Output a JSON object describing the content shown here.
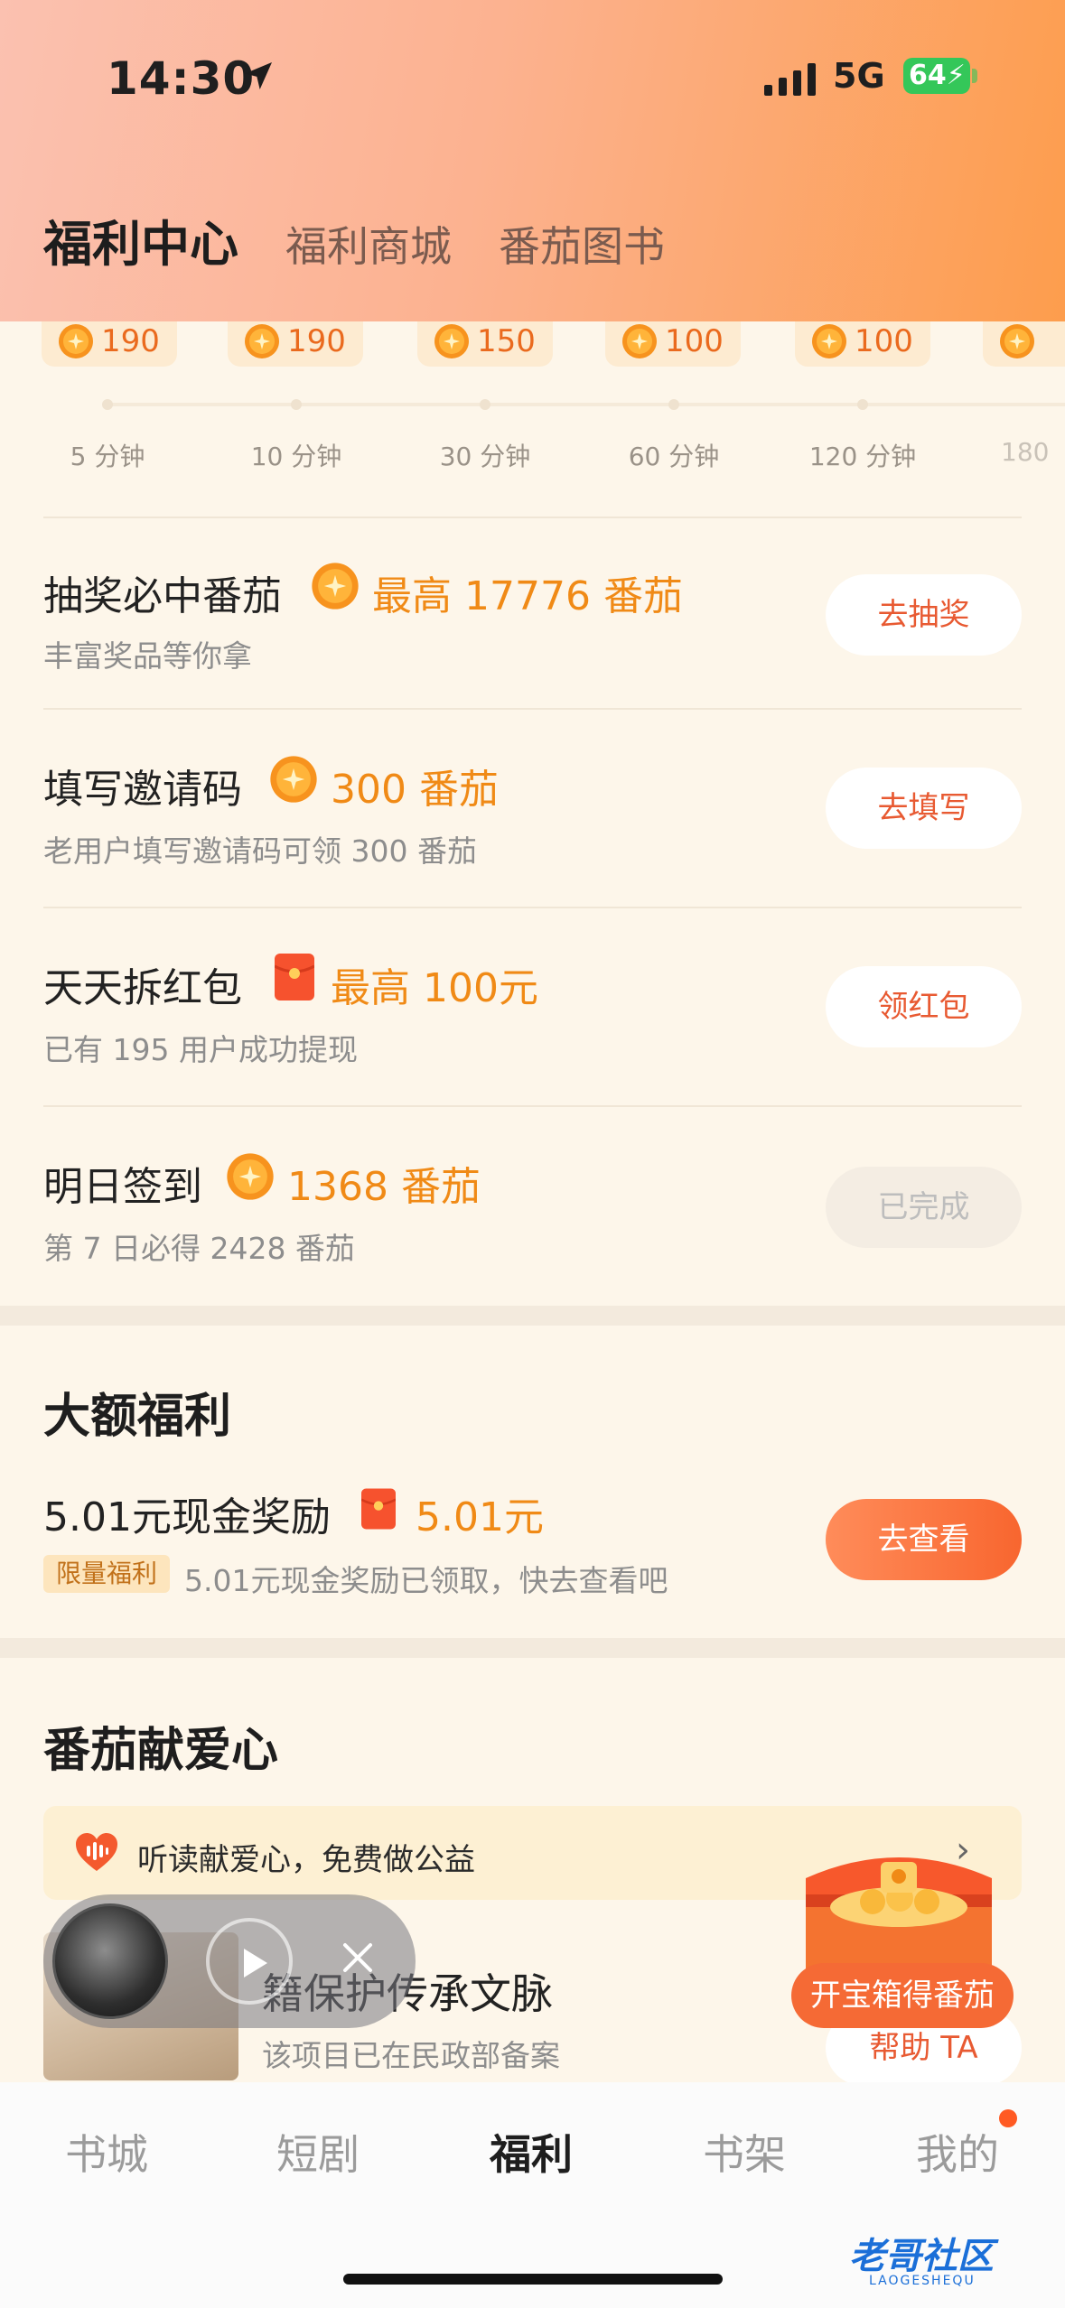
{
  "status_bar": {
    "time": "14:30",
    "network": "5G",
    "battery": "64"
  },
  "header": {
    "tabs": [
      "福利中心",
      "福利商城",
      "番茄图书"
    ],
    "active_tab": 0
  },
  "reading_rewards": [
    {
      "coins": "190",
      "duration": "5 分钟"
    },
    {
      "coins": "190",
      "duration": "10 分钟"
    },
    {
      "coins": "150",
      "duration": "30 分钟"
    },
    {
      "coins": "100",
      "duration": "60 分钟"
    },
    {
      "coins": "100",
      "duration": "120 分钟"
    },
    {
      "coins": "",
      "duration": "180"
    }
  ],
  "tasks": [
    {
      "title": "抽奖必中番茄",
      "reward": "最高 17776 番茄",
      "subtitle": "丰富奖品等你拿",
      "button": "去抽奖",
      "icon": "coin-icon",
      "state": "active"
    },
    {
      "title": "填写邀请码",
      "reward": "300 番茄",
      "subtitle": "老用户填写邀请码可领 300 番茄",
      "button": "去填写",
      "icon": "coin-icon",
      "state": "active"
    },
    {
      "title": "天天拆红包",
      "reward": "最高 100元",
      "subtitle": "已有 195 用户成功提现",
      "button": "领红包",
      "icon": "red-envelope-icon",
      "state": "active"
    },
    {
      "title": "明日签到",
      "reward": "1368 番茄",
      "subtitle": "第 7 日必得 2428 番茄",
      "button": "已完成",
      "icon": "coin-icon",
      "state": "done"
    }
  ],
  "big_benefits": {
    "section_title": "大额福利",
    "title": "5.01元现金奖励",
    "reward": "5.01元",
    "tag": "限量福利",
    "subtitle": "5.01元现金奖励已领取，快去查看吧",
    "button": "去查看"
  },
  "charity": {
    "section_title": "番茄献爱心",
    "banner_text": "听读献爱心，免费做公益",
    "project_title": "籍保护传承文脉",
    "project_subtitle": "该项目已在民政部备案",
    "project_button": "帮助 TA",
    "chest_button": "开宝箱得番茄"
  },
  "bottom_nav": {
    "items": [
      "书城",
      "短剧",
      "福利",
      "书架",
      "我的"
    ],
    "active": 2
  },
  "watermark": {
    "title": "老哥社区",
    "subtitle": "LAOGESHEQU"
  },
  "colors": {
    "accent": "#f08a16",
    "button_text": "#e85a32",
    "header_start": "#fbc1b0",
    "header_end": "#fd9d4d"
  }
}
